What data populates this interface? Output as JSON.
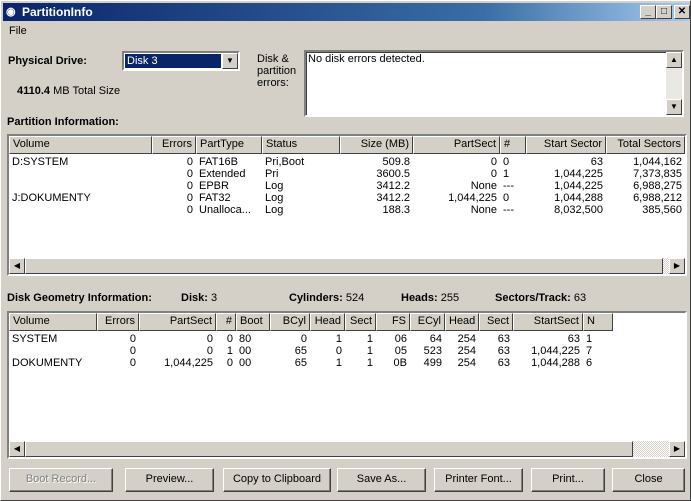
{
  "window": {
    "title": "PartitionInfo",
    "menu": [
      "File"
    ]
  },
  "drive": {
    "label": "Physical Drive:",
    "selected": "Disk 3",
    "total_size_value": "4110.4",
    "total_size_suffix": "MB Total Size",
    "errors_label": "Disk & partition errors:",
    "errors_text": "No disk errors detected."
  },
  "partition": {
    "section_title": "Partition Information:",
    "columns": [
      "Volume",
      "Errors",
      "PartType",
      "Status",
      "Size (MB)",
      "PartSect",
      "#",
      "Start Sector",
      "Total Sectors"
    ],
    "rows": [
      [
        "D:SYSTEM",
        "0",
        "FAT16B",
        "Pri,Boot",
        "509.8",
        "0",
        "0",
        "63",
        "1,044,162"
      ],
      [
        "",
        "0",
        "Extended",
        "Pri",
        "3600.5",
        "0",
        "1",
        "1,044,225",
        "7,373,835"
      ],
      [
        "",
        "0",
        "EPBR",
        "Log",
        "3412.2",
        "None",
        "---",
        "1,044,225",
        "6,988,275"
      ],
      [
        "J:DOKUMENTY",
        "0",
        "FAT32",
        "Log",
        "3412.2",
        "1,044,225",
        "0",
        "1,044,288",
        "6,988,212"
      ],
      [
        "",
        "0",
        "Unalloca...",
        "Log",
        "188.3",
        "None",
        "---",
        "8,032,500",
        "385,560"
      ]
    ]
  },
  "geometry": {
    "section_title": "Disk Geometry Information:",
    "disk_label": "Disk:",
    "disk_value": "3",
    "cylinders_label": "Cylinders:",
    "cylinders_value": "524",
    "heads_label": "Heads:",
    "heads_value": "255",
    "spt_label": "Sectors/Track:",
    "spt_value": "63",
    "columns": [
      "Volume",
      "Errors",
      "PartSect",
      "#",
      "Boot",
      "BCyl",
      "Head",
      "Sect",
      "FS",
      "ECyl",
      "Head",
      "Sect",
      "StartSect",
      "N"
    ],
    "rows": [
      [
        "SYSTEM",
        "0",
        "0",
        "0",
        "80",
        "0",
        "1",
        "1",
        "06",
        "64",
        "254",
        "63",
        "63",
        "1"
      ],
      [
        "",
        "0",
        "0",
        "1",
        "00",
        "65",
        "0",
        "1",
        "05",
        "523",
        "254",
        "63",
        "1,044,225",
        "7"
      ],
      [
        "DOKUMENTY",
        "0",
        "1,044,225",
        "0",
        "00",
        "65",
        "1",
        "1",
        "0B",
        "499",
        "254",
        "63",
        "1,044,288",
        "6"
      ]
    ]
  },
  "buttons": {
    "boot_record": "Boot Record...",
    "preview": "Preview...",
    "copy": "Copy to Clipboard",
    "save_as": "Save As...",
    "printer_font": "Printer Font...",
    "print": "Print...",
    "close": "Close"
  }
}
